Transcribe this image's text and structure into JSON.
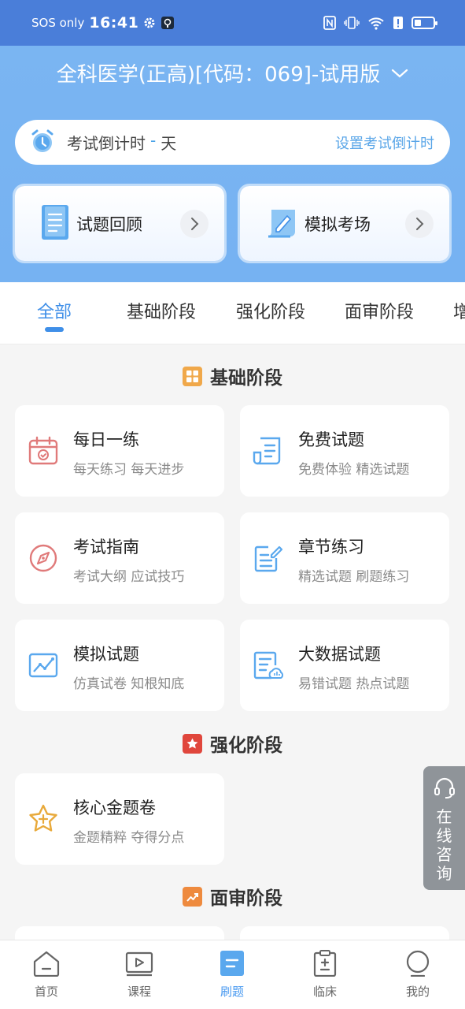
{
  "status_bar": {
    "carrier": "SOS only",
    "time": "16:41"
  },
  "header": {
    "course_title": "全科医学(正高)[代码：069]-试用版"
  },
  "countdown": {
    "label": "考试倒计时",
    "dash": "-",
    "unit": "天",
    "set_link": "设置考试倒计时"
  },
  "quick_actions": [
    {
      "label": "试题回顾"
    },
    {
      "label": "模拟考场"
    }
  ],
  "tabs": [
    {
      "label": "全部"
    },
    {
      "label": "基础阶段"
    },
    {
      "label": "强化阶段"
    },
    {
      "label": "面审阶段"
    },
    {
      "label": "增"
    }
  ],
  "sections": {
    "basic": {
      "title": "基础阶段",
      "cards": [
        {
          "title": "每日一练",
          "subtitle": "每天练习 每天进步"
        },
        {
          "title": "免费试题",
          "subtitle": "免费体验 精选试题"
        },
        {
          "title": "考试指南",
          "subtitle": "考试大纲 应试技巧"
        },
        {
          "title": "章节练习",
          "subtitle": "精选试题 刷题练习"
        },
        {
          "title": "模拟试题",
          "subtitle": "仿真试卷 知根知底"
        },
        {
          "title": "大数据试题",
          "subtitle": "易错试题 热点试题"
        }
      ]
    },
    "intensive": {
      "title": "强化阶段",
      "cards": [
        {
          "title": "核心金题卷",
          "subtitle": "金题精粹 夺得分点"
        }
      ]
    },
    "review": {
      "title": "面审阶段"
    }
  },
  "consult": {
    "text": "在线咨询"
  },
  "bottom_nav": [
    {
      "label": "首页"
    },
    {
      "label": "课程"
    },
    {
      "label": "刷题"
    },
    {
      "label": "临床"
    },
    {
      "label": "我的"
    }
  ],
  "colors": {
    "header_blue": "#76b2f2",
    "status_blue": "#4a7ed9",
    "accent_blue": "#3f8fe8",
    "basic_badge": "#f0a84a",
    "intensive_badge": "#e0463c",
    "review_badge": "#ee8a3e"
  }
}
